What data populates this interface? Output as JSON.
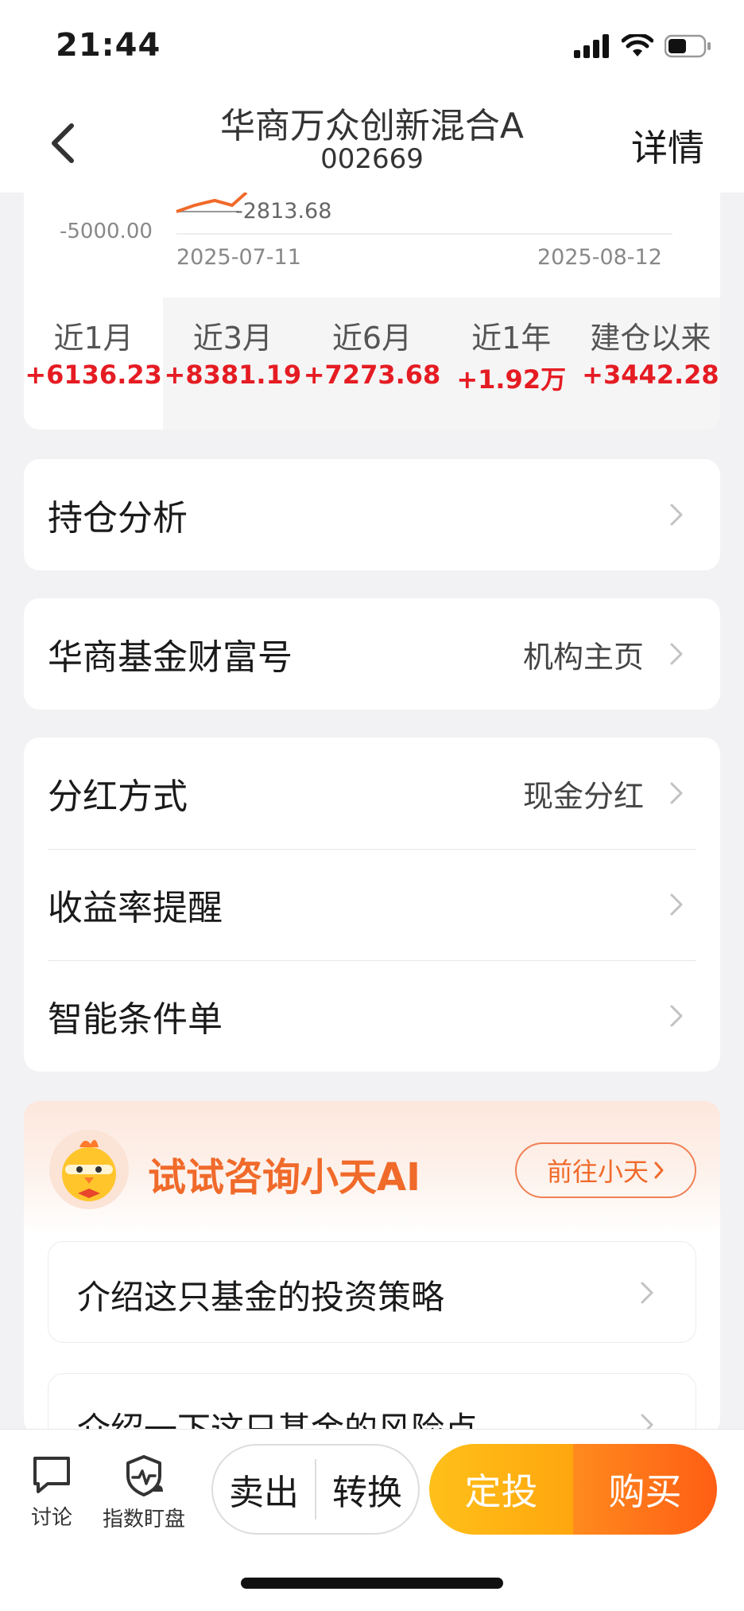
{
  "status": {
    "time": "21:44"
  },
  "nav": {
    "title": "华商万众创新混合A",
    "code": "002669",
    "detail": "详情"
  },
  "chart": {
    "y_axis_label": "-5000.00",
    "point_label": "-2813.68",
    "date_start": "2025-07-11",
    "date_end": "2025-08-12",
    "line_color": "#f06a2a"
  },
  "periods": [
    {
      "label": "近1月",
      "value": "+6136.23"
    },
    {
      "label": "近3月",
      "value": "+8381.19"
    },
    {
      "label": "近6月",
      "value": "+7273.68"
    },
    {
      "label": "近1年",
      "value": "+1.92万"
    },
    {
      "label": "建仓以来",
      "value": "+3442.28"
    }
  ],
  "menu": {
    "holdings": "持仓分析",
    "wealth_label": "华商基金财富号",
    "wealth_value": "机构主页",
    "dividend_label": "分红方式",
    "dividend_value": "现金分红",
    "yield_alert": "收益率提醒",
    "smart_order": "智能条件单"
  },
  "ai": {
    "title": "试试咨询小天AI",
    "go_label": "前往小天",
    "questions": [
      "介绍这只基金的投资策略",
      "介绍一下这只基金的风险点"
    ]
  },
  "bottom": {
    "discuss": "讨论",
    "index_watch": "指数盯盘",
    "sell": "卖出",
    "convert": "转换",
    "auto_invest": "定投",
    "buy": "购买"
  },
  "colors": {
    "accent": "#f06a2a",
    "gain": "#e51c23",
    "buy_start": "#ffc01a",
    "buy_end": "#ff5e14"
  }
}
